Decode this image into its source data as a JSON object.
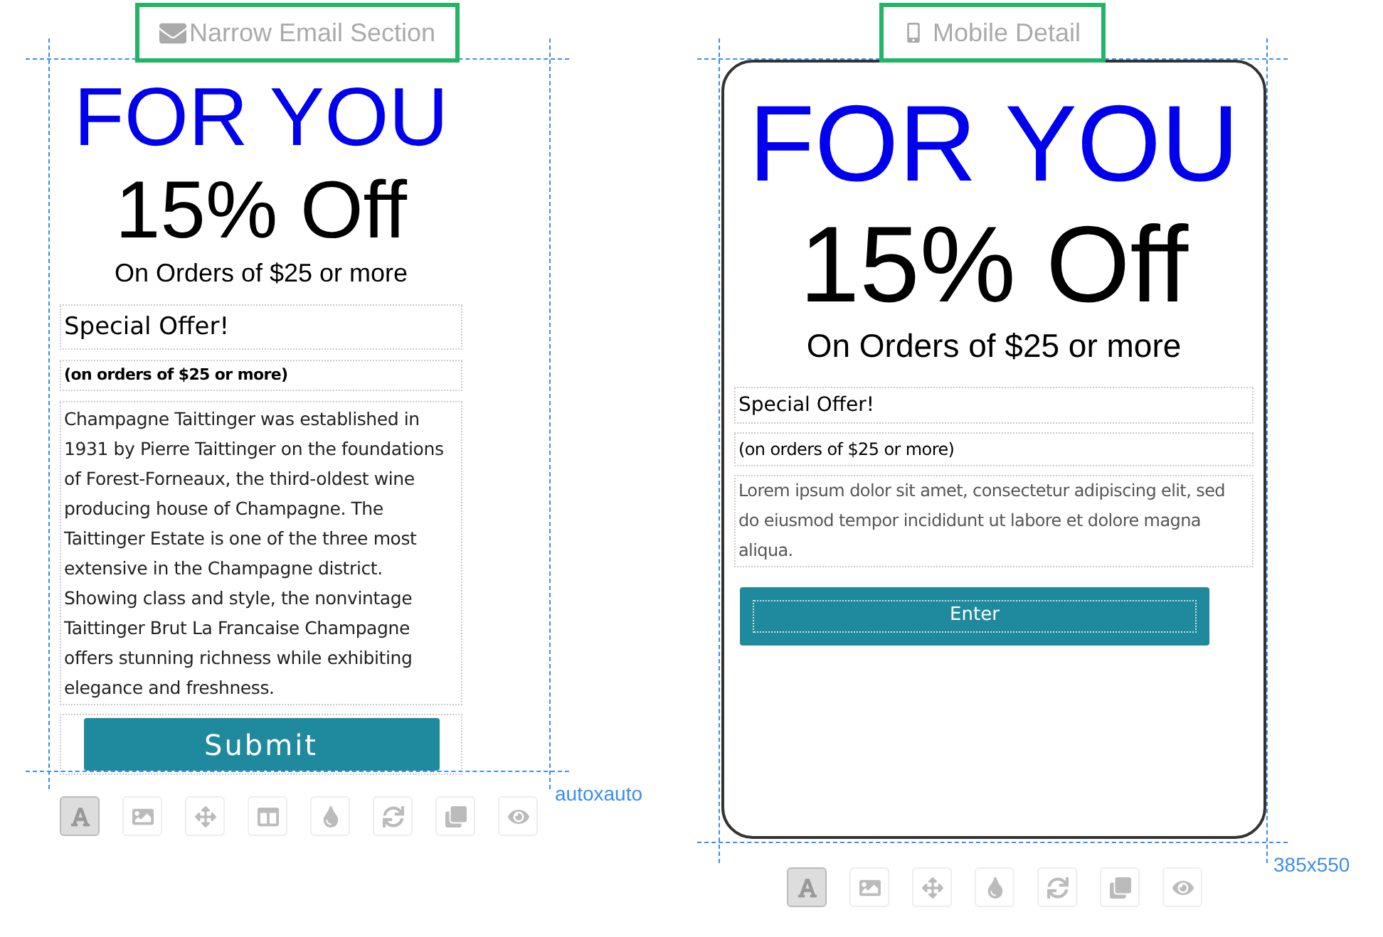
{
  "panels": [
    {
      "kind": "email",
      "title": "Narrow Email Section",
      "size": "autoxauto",
      "headline": "FOR YOU",
      "discount": "15% Off",
      "condition": "On Orders of $25 or more",
      "offer_title": "Special Offer!",
      "offer_subtitle": "(on orders of $25 or more)",
      "body": "Champagne Taittinger was established in 1931 by Pierre Taittinger on the foundations of Forest-Forneaux, the third-oldest wine producing house of Champagne. The Taittinger Estate is one of the three most extensive in the Champagne district. Showing class and style, the nonvintage Taittinger Brut La Francaise Champagne offers stunning richness while exhibiting elegance and freshness.",
      "button": "Submit",
      "tools": [
        {
          "kind": "text",
          "selected": true
        },
        {
          "kind": "image",
          "selected": false
        },
        {
          "kind": "move",
          "selected": false
        },
        {
          "kind": "layout",
          "selected": false
        },
        {
          "kind": "color",
          "selected": false
        },
        {
          "kind": "refresh",
          "selected": false
        },
        {
          "kind": "copy",
          "selected": false
        },
        {
          "kind": "preview",
          "selected": false
        }
      ]
    },
    {
      "kind": "mobile",
      "title": "Mobile Detail",
      "size": "385x550",
      "headline": "FOR YOU",
      "discount": "15% Off",
      "condition": "On Orders of $25 or more",
      "offer_title": "Special Offer!",
      "offer_subtitle": "(on orders of $25 or more)",
      "body": "Lorem ipsum dolor sit amet, consectetur adipiscing elit, sed do eiusmod tempor incididunt ut labore et dolore magna aliqua.",
      "button": "Enter",
      "tools": [
        {
          "kind": "text",
          "selected": true
        },
        {
          "kind": "image",
          "selected": false
        },
        {
          "kind": "move",
          "selected": false
        },
        {
          "kind": "color",
          "selected": false
        },
        {
          "kind": "refresh",
          "selected": false
        },
        {
          "kind": "copy",
          "selected": false
        },
        {
          "kind": "preview",
          "selected": false
        }
      ]
    }
  ]
}
